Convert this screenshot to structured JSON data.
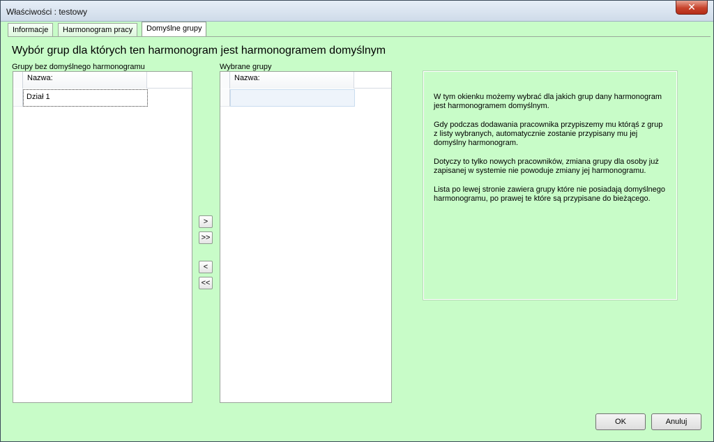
{
  "window": {
    "title": "Właściwości : testowy",
    "close_glyph": "✕"
  },
  "tabs": [
    {
      "label": "Informacje",
      "active": false
    },
    {
      "label": "Harmonogram pracy",
      "active": false
    },
    {
      "label": "Domyślne grupy",
      "active": true
    }
  ],
  "heading": "Wybór grup dla których ten harmonogram jest harmonogramem domyślnym",
  "left_list": {
    "label": "Grupy bez domyślnego harmonogramu",
    "column_header": "Nazwa:",
    "rows": [
      "Dział 1"
    ]
  },
  "right_list": {
    "label": "Wybrane grupy",
    "column_header": "Nazwa:",
    "rows": []
  },
  "transfer_buttons": {
    "move_one_right": ">",
    "move_all_right": ">>",
    "move_one_left": "<",
    "move_all_left": "<<"
  },
  "info": {
    "p1": "W tym okienku możemy wybrać dla jakich grup dany harmonogram jest harmonogramem domyślnym.",
    "p2": "Gdy podczas dodawania pracownika przypiszemy mu którąś z grup z listy wybranych, automatycznie zostanie przypisany mu jej domyślny harmonogram.",
    "p3": "Dotyczy to tylko nowych pracowników, zmiana grupy dla osoby już zapisanej w systemie nie powoduje zmiany jej harmonogramu.",
    "p4": "Lista po lewej stronie zawiera grupy które nie posiadają domyślnego harmonogramu, po prawej te które są przypisane do bieżącego."
  },
  "buttons": {
    "ok": "OK",
    "cancel": "Anuluj"
  },
  "colors": {
    "background": "#c8fcc8",
    "close_button": "#c7432c"
  }
}
